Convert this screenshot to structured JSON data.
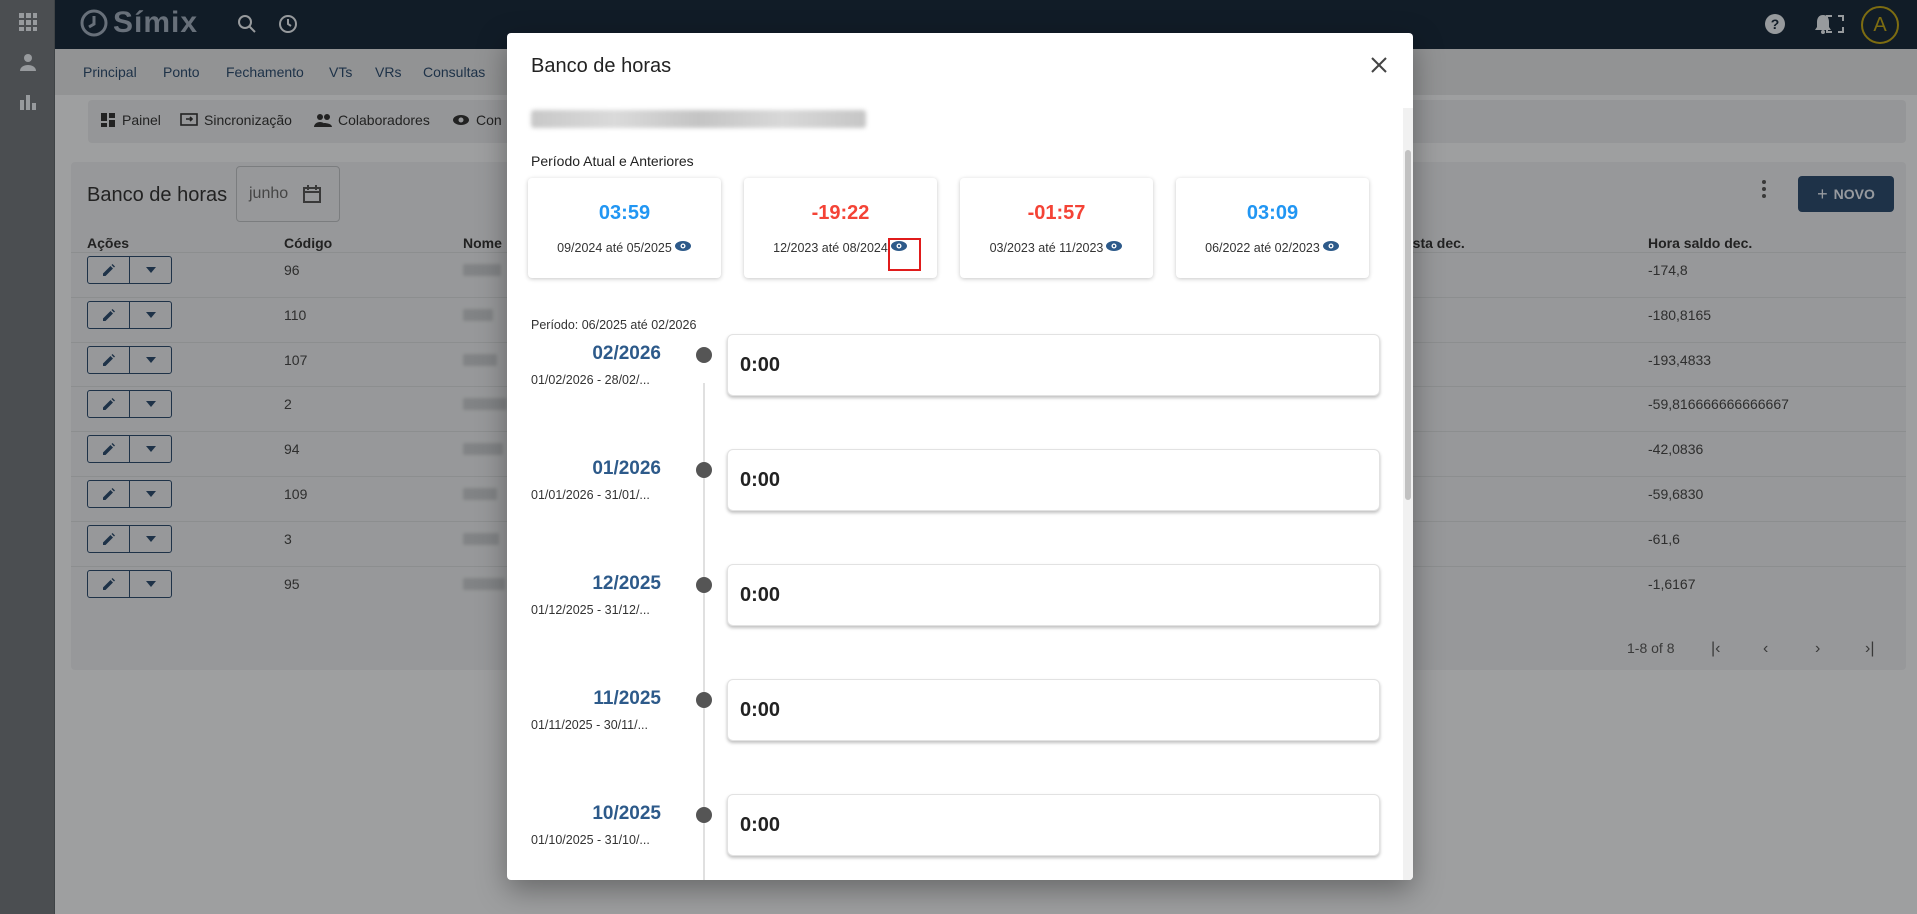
{
  "app": {
    "logo_text": "Símix",
    "avatar_letter": "A"
  },
  "nav": [
    "Principal",
    "Ponto",
    "Fechamento",
    "VTs",
    "VRs",
    "Consultas"
  ],
  "toolbar": {
    "painel": "Painel",
    "sincronizacao": "Sincronização",
    "colaboradores": "Colaboradores",
    "con": "Con"
  },
  "card": {
    "title": "Banco de horas",
    "month_value": "junho",
    "novo_label": "NOVO",
    "headers": {
      "acoes": "Ações",
      "codigo": "Código",
      "nome": "Nome",
      "prevista": "vista dec.",
      "saldo": "Hora saldo dec."
    },
    "rows": [
      {
        "codigo": "96",
        "saldo": "-174,8"
      },
      {
        "codigo": "110",
        "saldo": "-180,8165"
      },
      {
        "codigo": "107",
        "saldo": "-193,4833"
      },
      {
        "codigo": "2",
        "saldo": "-59,816666666666667"
      },
      {
        "codigo": "94",
        "saldo": "-42,0836"
      },
      {
        "codigo": "109",
        "saldo": "-59,6830"
      },
      {
        "codigo": "3",
        "saldo": "-61,6"
      },
      {
        "codigo": "95",
        "saldo": "-1,6167"
      }
    ],
    "pager": "1-8 of 8"
  },
  "modal": {
    "title": "Banco de horas",
    "section_label": "Período Atual e Anteriores",
    "periods": [
      {
        "value": "03:59",
        "range": "09/2024 até 05/2025",
        "sign": "pos"
      },
      {
        "value": "-19:22",
        "range": "12/2023 até 08/2024",
        "sign": "neg"
      },
      {
        "value": "-01:57",
        "range": "03/2023 até 11/2023",
        "sign": "neg"
      },
      {
        "value": "03:09",
        "range": "06/2022 até 02/2023",
        "sign": "pos"
      }
    ],
    "period_label": "Período: 06/2025 até 02/2026",
    "timeline": [
      {
        "month": "02/2026",
        "range": "01/02/2026 - 28/02/...",
        "value": "0:00"
      },
      {
        "month": "01/2026",
        "range": "01/01/2026 - 31/01/...",
        "value": "0:00"
      },
      {
        "month": "12/2025",
        "range": "01/12/2025 - 31/12/...",
        "value": "0:00"
      },
      {
        "month": "11/2025",
        "range": "01/11/2025 - 30/11/...",
        "value": "0:00"
      },
      {
        "month": "10/2025",
        "range": "01/10/2025 - 31/10/...",
        "value": "0:00"
      }
    ]
  },
  "colors": {
    "brand": "#2d4b6b",
    "positive": "#2196f3",
    "negative": "#f44336",
    "highlight": "#e01b1b"
  }
}
